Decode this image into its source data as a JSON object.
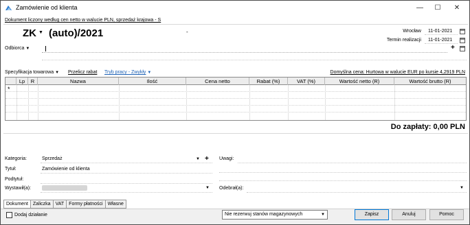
{
  "window": {
    "title": "Zamówienie od klienta",
    "controls": {
      "minimize": "—",
      "maximize": "☐",
      "close": "✕"
    }
  },
  "header": {
    "currency_note": "Dokument liczony według cen netto w walucie PLN, sprzedaż krajowa - S",
    "doc_prefix": "ZK",
    "doc_number": "(auto)/2021",
    "dash": "-",
    "place_label": "Wrocław",
    "place_date": "11-01-2021",
    "termin_label": "Termin realizacji",
    "termin_date": "11-01-2021",
    "odbiorca_label": "Odbiorca"
  },
  "toolbar": {
    "spec_label": "Specyfikacja towarowa",
    "recalc_label": "Przelicz rabat",
    "work_mode_label": "Tryb pracy - Zwykły",
    "default_price": "Domyślna cena: Hurtowa w walucie EUR po kursie 4,2919 PLN"
  },
  "table": {
    "columns": [
      "Lp",
      "R",
      "Nazwa",
      "Ilość",
      "Cena netto",
      "Rabat (%)",
      "VAT (%)",
      "Wartość netto (R)",
      "Wartość brutto (R)"
    ],
    "new_row_marker": "*"
  },
  "summary": {
    "total": "Do zapłaty: 0,00 PLN"
  },
  "form": {
    "kategoria_label": "Kategoria:",
    "kategoria_value": "Sprzedaż",
    "tytul_label": "Tytuł:",
    "tytul_value": "Zamówienie od klienta",
    "podtytul_label": "Podtytuł:",
    "wystawil_label": "Wystawił(a):",
    "uwagi_label": "Uwagi:",
    "odebral_label": "Odebrał(a):"
  },
  "tabs": [
    "Dokument",
    "Zaliczka",
    "VAT",
    "Formy płatności",
    "Własne"
  ],
  "bottom": {
    "add_action_label": "Dodaj działanie",
    "stock_select": "Nie rezerwuj stanów magazynowych",
    "save": "Zapisz",
    "cancel": "Anuluj",
    "help": "Pomoc"
  }
}
